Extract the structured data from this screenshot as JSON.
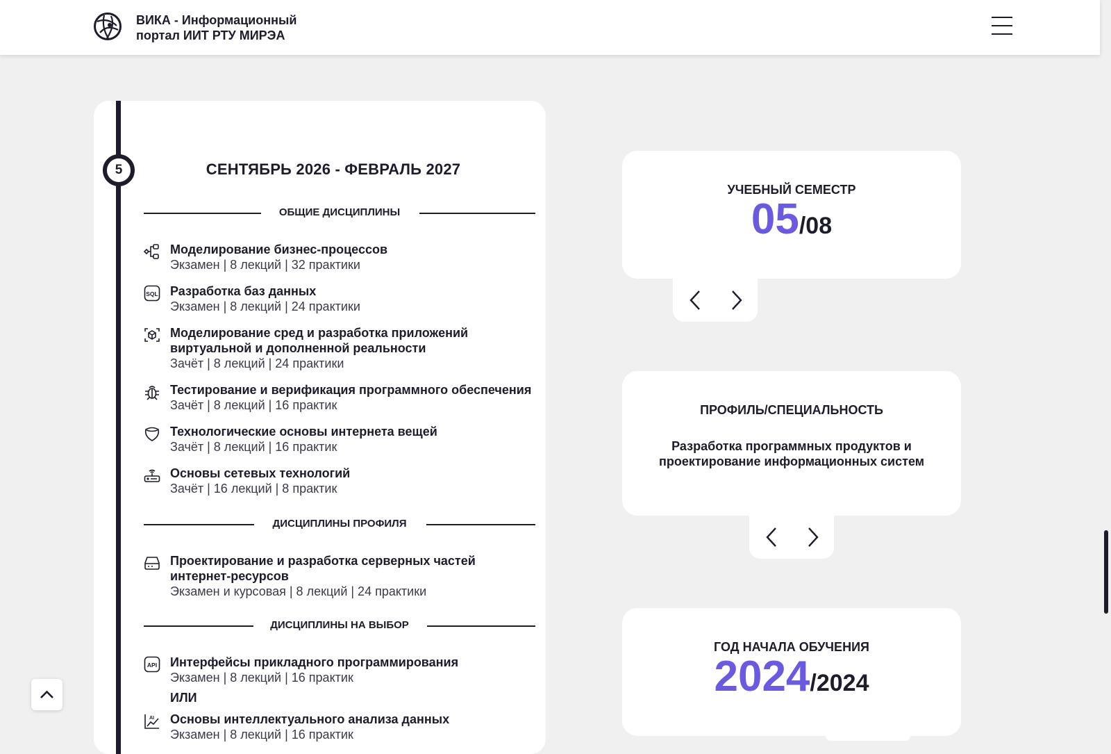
{
  "header": {
    "brand_line1": "ВИКА - Информационный",
    "brand_line2": "портал ИИТ РТУ МИРЭА"
  },
  "timeline": {
    "step": "5",
    "period": "СЕНТЯБРЬ 2026 - ФЕВРАЛЬ 2027",
    "sections": {
      "general": "ОБЩИЕ ДИСЦИПЛИНЫ",
      "profile": "ДИСЦИПЛИНЫ ПРОФИЛЯ",
      "elective": "ДИСЦИПЛИНЫ НА ВЫБОР"
    },
    "general": [
      {
        "icon": "business-process-icon",
        "name": "Моделирование бизнес-процессов",
        "meta": "Экзамен | 8 лекций | 32 практики"
      },
      {
        "icon": "sql-icon",
        "name": "Разработка баз данных",
        "meta": "Экзамен | 8 лекций | 24 практики"
      },
      {
        "icon": "ar-vr-cube-icon",
        "name": "Моделирование сред и разработка приложений виртуальной и дополненной реальности",
        "meta": "Зачёт | 8 лекций | 24 практики"
      },
      {
        "icon": "bug-icon",
        "name": "Тестирование и верификация программного обеспечения",
        "meta": "Зачёт | 8 лекций | 16 практик"
      },
      {
        "icon": "iot-device-icon",
        "name": "Технологические основы интернета вещей",
        "meta": "Зачёт | 8 лекций | 16 практик"
      },
      {
        "icon": "router-icon",
        "name": "Основы сетевых технологий",
        "meta": "Зачёт | 16 лекций | 8 практик"
      }
    ],
    "profile": [
      {
        "icon": "server-icon",
        "name": "Проектирование и разработка серверных частей интернет-ресурсов",
        "meta": "Экзамен и курсовая | 8 лекций | 24 практики"
      }
    ],
    "elective": [
      {
        "icon": "api-icon",
        "name": "Интерфейсы прикладного программирования",
        "meta": "Экзамен | 8 лекций | 16 практик"
      },
      {
        "icon": "ai-chart-icon",
        "name": "Основы интеллектуального анализа данных",
        "meta": "Экзамен | 8 лекций | 16 практик"
      }
    ],
    "or_label": "ИЛИ"
  },
  "semester": {
    "label": "УЧЕБНЫЙ СЕМЕСТР",
    "current": "05",
    "total": "/08"
  },
  "profile": {
    "label": "ПРОФИЛЬ/СПЕЦИАЛЬНОСТЬ",
    "text": "Разработка программных продуктов и проектирование информационных систем"
  },
  "year": {
    "label": "ГОД НАЧАЛА ОБУЧЕНИЯ",
    "current": "2024",
    "total": "/2024"
  }
}
